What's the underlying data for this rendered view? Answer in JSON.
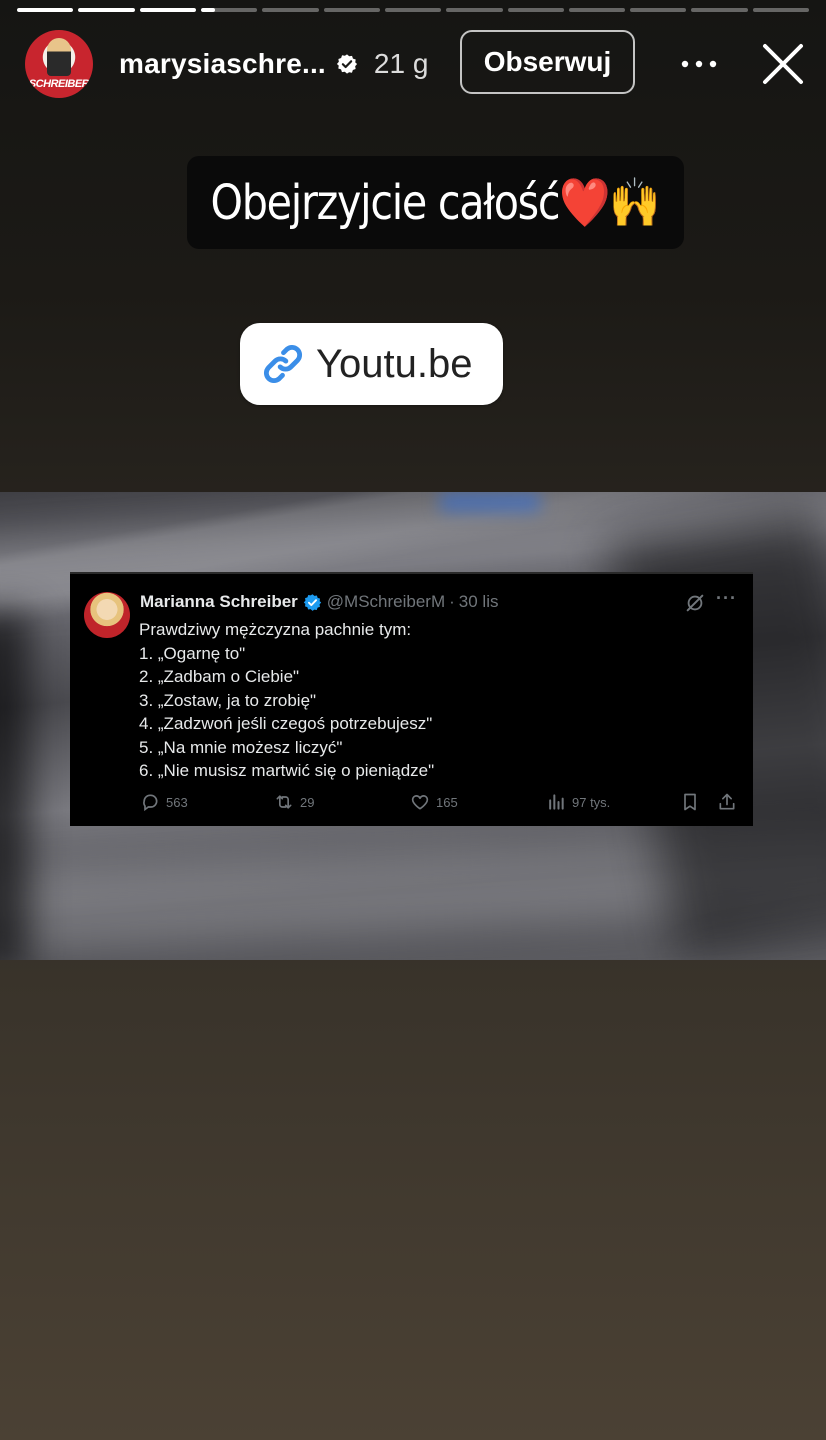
{
  "story": {
    "segments_total": 13,
    "current_segment_index": 3,
    "current_segment_progress": 0.25
  },
  "header": {
    "username": "marysiaschre...",
    "time": "21 g",
    "follow_label": "Obserwuj",
    "avatar_logo": "SCHREIBER",
    "icons": {
      "verified": "verified-badge-icon",
      "more": "more-options-icon",
      "close": "close-icon"
    }
  },
  "caption": {
    "text": "Obejrzyjcie całość",
    "emoji": "❤️🙌"
  },
  "link_sticker": {
    "label": "Youtu.be",
    "icon": "link-icon"
  },
  "tweet": {
    "author_name": "Marianna Schreiber",
    "handle": "@MSchreiberM",
    "separator": "·",
    "date": "30 lis",
    "lines": [
      "Prawdziwy mężczyzna pachnie tym:",
      "1. „Ogarnę to\"",
      "2. „Zadbam o Ciebie\"",
      "3. „Zostaw, ja to zrobię\"",
      "4. „Zadzwoń jeśli czegoś potrzebujesz\"",
      "5. „Na mnie możesz liczyć\"",
      "6. „Nie musisz martwić się o pieniądze\""
    ],
    "replies": "563",
    "retweets": "29",
    "likes": "165",
    "views": "97 tys.",
    "colors": {
      "verified": "#1d9bf0",
      "muted": "#71767b",
      "text": "#e7e9ea"
    }
  }
}
